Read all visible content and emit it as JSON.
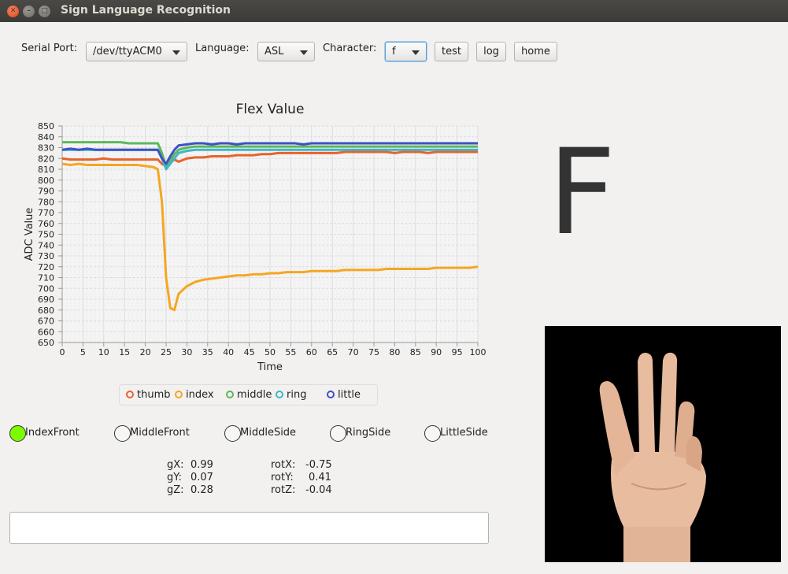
{
  "window": {
    "title": "Sign Language Recognition"
  },
  "toolbar": {
    "serial_label": "Serial Port:",
    "serial_value": "/dev/ttyACM0",
    "language_label": "Language:",
    "language_value": "ASL",
    "character_label": "Character:",
    "character_value": "f",
    "test_label": "test",
    "log_label": "log",
    "home_label": "home"
  },
  "chart_data": {
    "type": "line",
    "title": "Flex Value",
    "xlabel": "Time",
    "ylabel": "ADC Value",
    "xlim": [
      0,
      100
    ],
    "ylim": [
      650,
      850
    ],
    "x_ticks": [
      0,
      5,
      10,
      15,
      20,
      25,
      30,
      35,
      40,
      45,
      50,
      55,
      60,
      65,
      70,
      75,
      80,
      85,
      90,
      95,
      100
    ],
    "y_ticks": [
      650,
      660,
      670,
      680,
      690,
      700,
      710,
      720,
      730,
      740,
      750,
      760,
      770,
      780,
      790,
      800,
      810,
      820,
      830,
      840,
      850
    ],
    "grid": true,
    "legend_position": "bottom",
    "x": [
      0,
      2,
      4,
      6,
      8,
      10,
      12,
      14,
      16,
      18,
      20,
      22,
      23,
      24,
      25,
      26,
      27,
      28,
      30,
      32,
      34,
      36,
      38,
      40,
      42,
      44,
      46,
      48,
      50,
      52,
      54,
      56,
      58,
      60,
      62,
      64,
      66,
      68,
      70,
      72,
      74,
      76,
      78,
      80,
      82,
      84,
      86,
      88,
      90,
      92,
      94,
      96,
      98,
      100
    ],
    "series": [
      {
        "name": "thumb",
        "color": "#e8632b",
        "values": [
          820,
          819,
          819,
          819,
          819,
          820,
          819,
          819,
          819,
          819,
          819,
          819,
          819,
          815,
          813,
          816,
          819,
          817,
          820,
          821,
          821,
          822,
          822,
          822,
          823,
          823,
          823,
          824,
          824,
          825,
          825,
          825,
          825,
          825,
          825,
          825,
          825,
          826,
          826,
          826,
          826,
          826,
          826,
          825,
          826,
          826,
          826,
          825,
          826,
          826,
          826,
          826,
          826,
          826
        ]
      },
      {
        "name": "index",
        "color": "#f5a623",
        "values": [
          815,
          814,
          815,
          814,
          814,
          814,
          814,
          814,
          814,
          814,
          813,
          812,
          810,
          780,
          710,
          682,
          680,
          695,
          702,
          706,
          708,
          709,
          710,
          711,
          712,
          712,
          713,
          713,
          714,
          714,
          715,
          715,
          715,
          716,
          716,
          716,
          716,
          717,
          717,
          717,
          717,
          717,
          718,
          718,
          718,
          718,
          718,
          718,
          719,
          719,
          719,
          719,
          719,
          720
        ]
      },
      {
        "name": "middle",
        "color": "#5cb85c",
        "values": [
          835,
          835,
          835,
          835,
          835,
          835,
          835,
          835,
          834,
          834,
          834,
          834,
          834,
          825,
          812,
          818,
          824,
          828,
          830,
          831,
          831,
          831,
          831,
          831,
          831,
          831,
          831,
          831,
          831,
          831,
          831,
          831,
          831,
          831,
          831,
          831,
          831,
          831,
          831,
          831,
          831,
          831,
          831,
          831,
          831,
          831,
          831,
          831,
          831,
          831,
          831,
          831,
          831,
          831
        ]
      },
      {
        "name": "ring",
        "color": "#3fb6c6",
        "values": [
          828,
          828,
          828,
          828,
          828,
          828,
          828,
          828,
          828,
          828,
          828,
          828,
          828,
          820,
          810,
          815,
          820,
          825,
          827,
          828,
          828,
          828,
          828,
          828,
          828,
          828,
          828,
          828,
          828,
          828,
          828,
          828,
          828,
          828,
          828,
          828,
          828,
          828,
          828,
          828,
          828,
          828,
          828,
          828,
          828,
          828,
          828,
          828,
          828,
          828,
          828,
          828,
          828,
          828
        ]
      },
      {
        "name": "little",
        "color": "#3e51c5",
        "values": [
          828,
          829,
          828,
          829,
          828,
          828,
          828,
          828,
          828,
          828,
          828,
          828,
          828,
          820,
          815,
          822,
          828,
          832,
          833,
          834,
          834,
          833,
          834,
          834,
          833,
          834,
          834,
          834,
          834,
          834,
          834,
          834,
          833,
          834,
          834,
          834,
          834,
          834,
          834,
          834,
          834,
          834,
          834,
          834,
          834,
          834,
          834,
          834,
          834,
          834,
          834,
          834,
          834,
          834
        ]
      }
    ]
  },
  "legend": [
    {
      "label": "thumb",
      "color": "#e8632b"
    },
    {
      "label": "index",
      "color": "#f5a623"
    },
    {
      "label": "middle",
      "color": "#5cb85c"
    },
    {
      "label": "ring",
      "color": "#3fb6c6"
    },
    {
      "label": "little",
      "color": "#3e51c5"
    }
  ],
  "contacts": [
    {
      "label": "IndexFront",
      "active": true
    },
    {
      "label": "MiddleFront",
      "active": false
    },
    {
      "label": "MiddleSide",
      "active": false
    },
    {
      "label": "RingSide",
      "active": false
    },
    {
      "label": "LittleSide",
      "active": false
    }
  ],
  "sensors": {
    "gX_label": "gX:",
    "gX_value": "0.99",
    "gY_label": "gY:",
    "gY_value": "0.07",
    "gZ_label": "gZ:",
    "gZ_value": "0.28",
    "rotX_label": "rotX:",
    "rotX_value": "-0.75",
    "rotY_label": "rotY:",
    "rotY_value": "0.41",
    "rotZ_label": "rotZ:",
    "rotZ_value": "-0.04"
  },
  "output_text": "",
  "recognized_letter": "F",
  "colors": {
    "active_contact": "#7cfc00",
    "titlebar": "#3c3b37"
  }
}
